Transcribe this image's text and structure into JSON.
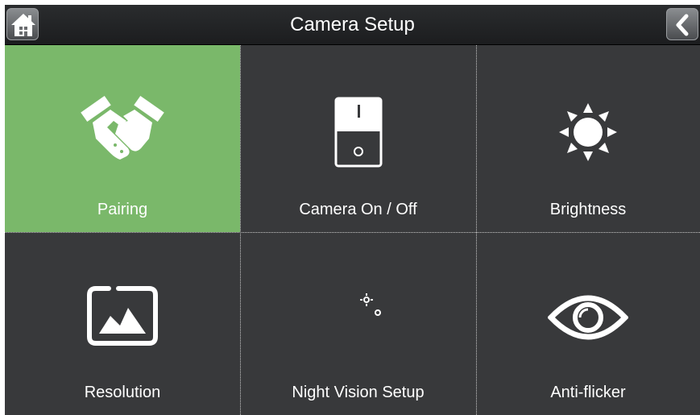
{
  "header": {
    "title": "Camera Setup",
    "home_icon": "home-icon",
    "back_icon": "chevron-left-icon"
  },
  "tiles": [
    {
      "label": "Pairing",
      "icon": "handshake-icon",
      "selected": true
    },
    {
      "label": "Camera On / Off",
      "icon": "power-switch-icon",
      "selected": false
    },
    {
      "label": "Brightness",
      "icon": "sun-icon",
      "selected": false
    },
    {
      "label": "Resolution",
      "icon": "image-icon",
      "selected": false
    },
    {
      "label": "Night Vision Setup",
      "icon": "moon-icon",
      "selected": false
    },
    {
      "label": "Anti-flicker",
      "icon": "eye-icon",
      "selected": false
    }
  ],
  "switch": {
    "on_mark": "I",
    "off_mark": "O"
  },
  "colors": {
    "selected": "#7ab86a",
    "tile": "#38393b",
    "bar": "#1f2022"
  }
}
